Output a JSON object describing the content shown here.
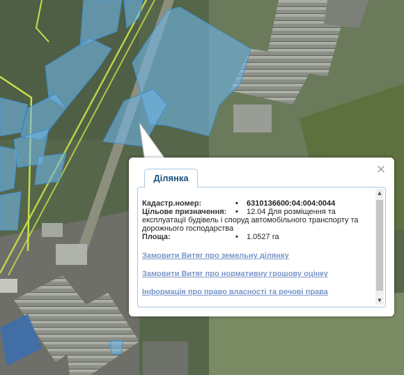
{
  "popup": {
    "tab_label": "Ділянка",
    "close_glyph": "×",
    "fields": [
      {
        "label": "Кадастр.номер:",
        "bullet": "•",
        "lines": [
          "6310136600:04:004:0044"
        ],
        "strong": true
      },
      {
        "label": "Цільове призначення:",
        "bullet": "•",
        "lines": [
          "12.04 Для розміщення та",
          "експлуатації будівель і споруд автомобільного транспорту та",
          "дорожнього господарства"
        ],
        "strong": false
      },
      {
        "label": "Площа:",
        "bullet": "•",
        "lines": [
          "1.0527 га"
        ],
        "strong": false
      }
    ],
    "links": [
      "Замовити Витяг про земельну ділянку",
      "Замовити Витяг про нормативну грошову оцінку",
      "Інформація про право власності та речові права"
    ],
    "scroll_up_glyph": "▲",
    "scroll_down_glyph": "▼"
  },
  "colors": {
    "parcel_fill": "#6fb5e8",
    "parcel_stroke": "#3d8fd0",
    "road_line": "#c8e04a",
    "tab_text": "#1f4f7a",
    "link_text": "#7a96c8"
  },
  "icons": [
    "close-icon",
    "scroll-up-icon",
    "scroll-down-icon"
  ]
}
